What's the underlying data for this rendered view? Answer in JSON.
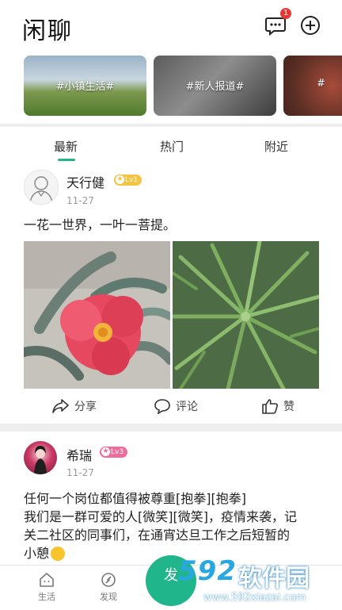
{
  "header": {
    "title": "闲聊",
    "message_badge": "1"
  },
  "topics": [
    {
      "label": "#小镇生活#"
    },
    {
      "label": "#新人报道#"
    },
    {
      "label": "#"
    }
  ],
  "tabs": [
    {
      "label": "最新",
      "active": true
    },
    {
      "label": "热门",
      "active": false
    },
    {
      "label": "附近",
      "active": false
    }
  ],
  "posts": [
    {
      "user": "天行健",
      "level": "Lv1",
      "date": "11-27",
      "text": "一花一世界，一叶一菩提。",
      "actions": {
        "share": "分享",
        "comment": "评论",
        "like": "赞"
      }
    },
    {
      "user": "希瑞",
      "level": "Lv3",
      "date": "11-27",
      "text_lines": [
        "任何一个岗位都值得被尊重[抱拳][抱拳]",
        "我们是一群可爱的人[微笑][微笑]，疫情来袭，记",
        "关二社区的同事们，在通宵达旦工作之后短暂的",
        "小憩"
      ]
    }
  ],
  "bottom_nav": {
    "life": "生活",
    "discover": "发现",
    "publish": "发"
  },
  "watermark": {
    "brand": "592",
    "soft": "软件园",
    "url": "www.592xiazai.com"
  },
  "colors": {
    "accent": "#21b58b",
    "badge": "#e53935",
    "lv1": "#f5c342",
    "lv3": "#f06d9b"
  }
}
